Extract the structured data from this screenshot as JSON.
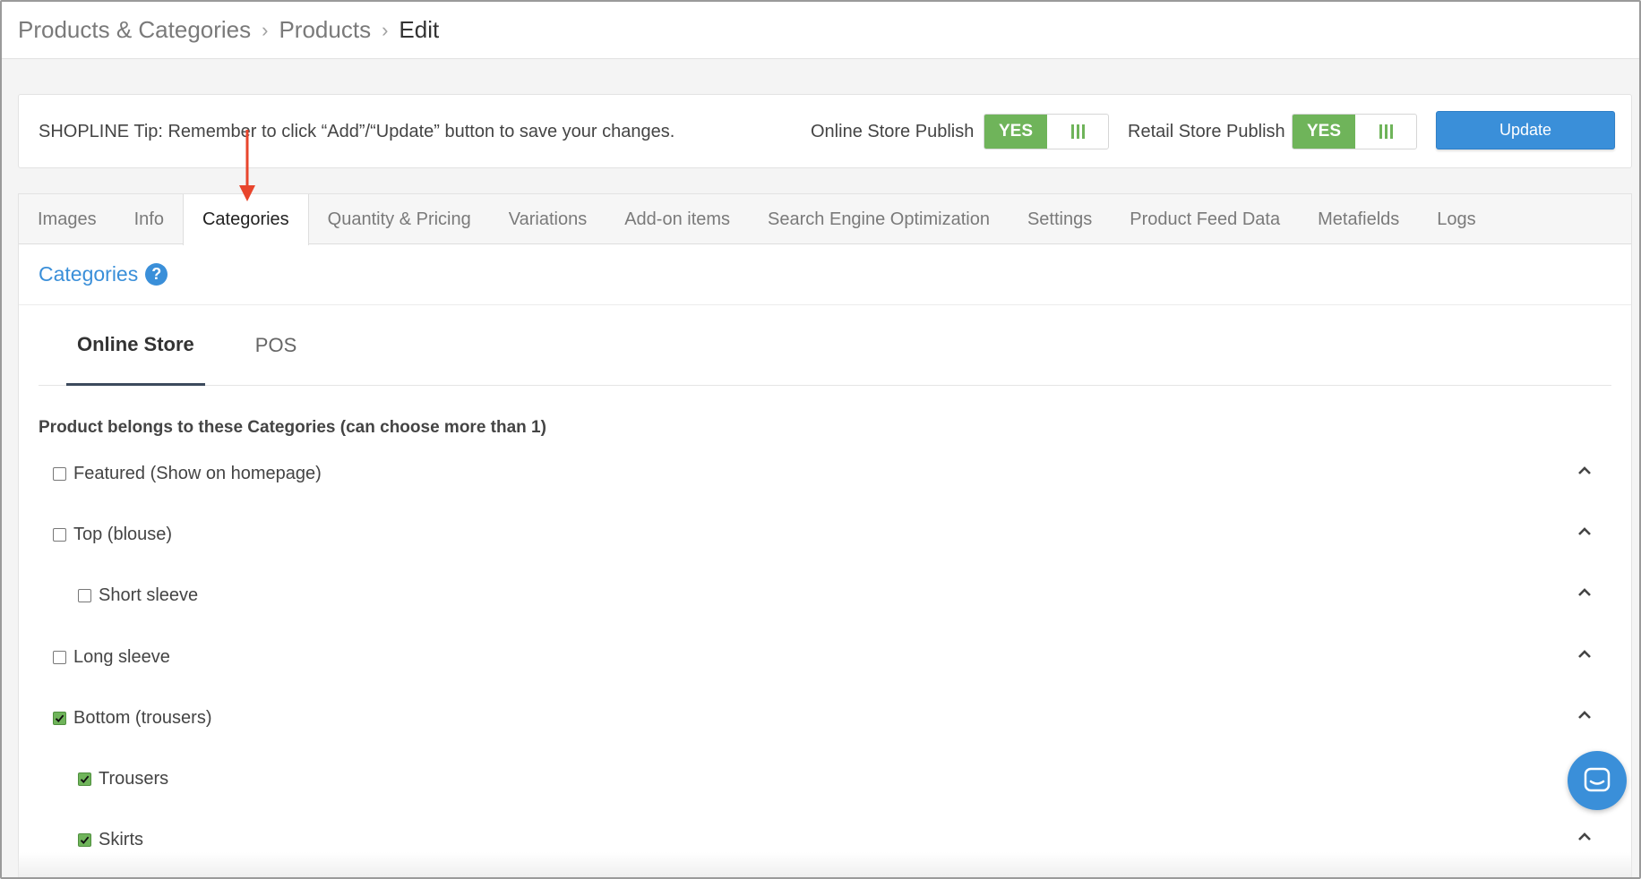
{
  "breadcrumb": [
    {
      "label": "Products & Categories"
    },
    {
      "label": "Products"
    },
    {
      "label": "Edit"
    }
  ],
  "tip": {
    "text": "SHOPLINE Tip: Remember to click “Add”/“Update” button to save your changes."
  },
  "publish": {
    "online_label": "Online Store Publish",
    "online_value": "YES",
    "retail_label": "Retail Store Publish",
    "retail_value": "YES"
  },
  "update_button": "Update",
  "tabs": [
    {
      "label": "Images"
    },
    {
      "label": "Info"
    },
    {
      "label": "Categories",
      "active": true
    },
    {
      "label": "Quantity & Pricing"
    },
    {
      "label": "Variations"
    },
    {
      "label": "Add-on items"
    },
    {
      "label": "Search Engine Optimization"
    },
    {
      "label": "Settings"
    },
    {
      "label": "Product Feed Data"
    },
    {
      "label": "Metafields"
    },
    {
      "label": "Logs"
    }
  ],
  "section": {
    "title": "Categories",
    "help_icon": "question-circle-icon"
  },
  "subtabs": [
    {
      "label": "Online Store",
      "active": true
    },
    {
      "label": "POS"
    }
  ],
  "list": {
    "title": "Product belongs to these Categories (can choose more than 1)",
    "items": [
      {
        "label": "Featured (Show on homepage)",
        "checked": false,
        "indent": 0
      },
      {
        "label": "Top (blouse)",
        "checked": false,
        "indent": 0
      },
      {
        "label": "Short sleeve",
        "checked": false,
        "indent": 1
      },
      {
        "label": "Long sleeve",
        "checked": false,
        "indent": 0
      },
      {
        "label": "Bottom (trousers)",
        "checked": true,
        "indent": 0
      },
      {
        "label": "Trousers",
        "checked": true,
        "indent": 1
      },
      {
        "label": "Skirts",
        "checked": true,
        "indent": 1
      }
    ]
  },
  "colors": {
    "accent_blue": "#3a8fd9",
    "toggle_green": "#6fb45a",
    "annotation_red": "#e8452c"
  },
  "icons": {
    "chevron": "chevron-up-icon",
    "chat": "chat-bubble-icon",
    "arrow": "red-arrow-annotation"
  }
}
